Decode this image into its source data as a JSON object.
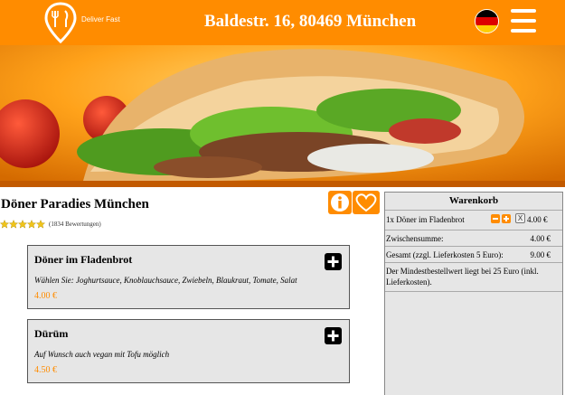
{
  "header": {
    "logo_text": "Deliver Fast",
    "address": "Baldestr. 16, 80469 München",
    "language_flag": "de-flag-icon",
    "menu_icon": "hamburger-menu-icon",
    "brand_color": "#ff8c00"
  },
  "hero": {
    "image": "doner-kebab-photo"
  },
  "restaurant": {
    "name": "Döner Paradies München",
    "stars": 5,
    "rating_count": "(1834 Bewertungen)"
  },
  "products": [
    {
      "name": "Döner im Fladenbrot",
      "description": "Wählen Sie: Joghurtsauce, Knoblauchsauce, Zwiebeln, Blaukraut, Tomate, Salat",
      "price": "4.00 €"
    },
    {
      "name": "Dürüm",
      "description": "Auf Wunsch auch vegan mit Tofu möglich",
      "price": "4.50 €"
    }
  ],
  "cart": {
    "title": "Warenkorb",
    "items": [
      {
        "label": "1x Döner im Fladenbrot",
        "remove": "X",
        "price": "4.00 €"
      }
    ],
    "subtotal_label": "Zwischensumme:",
    "subtotal_value": "4.00 €",
    "total_label": "Gesamt (zzgl. Lieferkosten 5 Euro):",
    "total_value": "9.00 €",
    "note": "Der Mindestbestellwert liegt bei 25 Euro (inkl. Lieferkosten)."
  }
}
